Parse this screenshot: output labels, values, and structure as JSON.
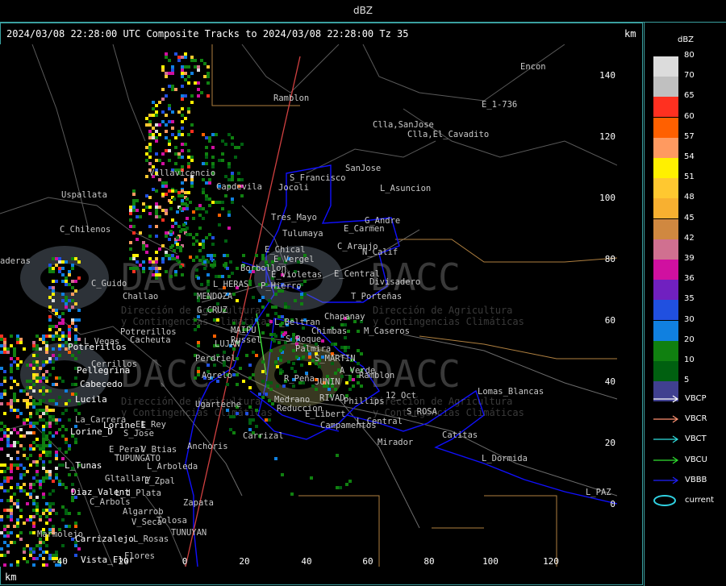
{
  "window": {
    "title": "dBZ"
  },
  "header": {
    "text": "2024/03/08 22:28:00 UTC Composite Tracks to 2024/03/08 22:28:00 Tz 35",
    "km_top": "km",
    "km_bottom": "km"
  },
  "axes": {
    "x_ticks": [
      "-40",
      "-20",
      "0",
      "20",
      "40",
      "60",
      "80",
      "100",
      "120"
    ],
    "y_ticks": [
      "140",
      "120",
      "100",
      "80",
      "60",
      "40",
      "20",
      "0"
    ]
  },
  "watermark": {
    "brand": "DACC",
    "line1": "Dirección de Agricultura",
    "line2": "y Contingencias Climáticas"
  },
  "places_white": [
    "Potrerillos",
    "Pellegrina",
    "Cabecedo",
    "Lucila",
    "Lorine_D",
    "Lorine_E",
    "L_Tunas",
    "Diaz_Valent",
    "Carrizalejo",
    "Vista_Flor"
  ],
  "places_gray": [
    "Ramblon",
    "Encon",
    "E_1-736",
    "Clla,SanJose",
    "Clla,El_Cavadito",
    "SanJose",
    "S_Francisco",
    "Jocoli",
    "L_Asuncion",
    "Villavicencio",
    "Capdevila",
    "Uspallata",
    "Tres_Mayo",
    "G_Andre",
    "Tulumaya",
    "E_Carmen",
    "C_Chilenos",
    "E_Chical",
    "E_Vergel",
    "C_Araujo",
    "N_Calif",
    "Borbollon",
    "E_Violetas",
    "E_Central",
    "Divisadero",
    "C_Guido",
    "P_Hierro",
    "L_HERAS",
    "Challao",
    "MENDOZA",
    "T_Porteñas",
    "G_CRUZ",
    "Chapanay",
    "L_Beltran",
    "Chimbas",
    "M_Caseros",
    "Potrerillos",
    "Cacheuta",
    "L_Vegas",
    "MAIPU",
    "Russel",
    "S_Roque",
    "LUJAN",
    "Palmira",
    "S_MARTIN",
    "Perdriel",
    "A_Verde",
    "Ramblon",
    "Agrelo",
    "R_Peña",
    "JUNIN",
    "RIVAD",
    "Phillips",
    "12_Oct",
    "Lomas_Blancas",
    "Medrano",
    "Reduccion",
    "E_Libert",
    "S_ROSA",
    "Ugarteche",
    "L_Central",
    "Campamentos",
    "El_Rey",
    "Carrizal",
    "S_Jose",
    "Catitas",
    "Mirador",
    "E_Peral",
    "V_Btias",
    "Anchoris",
    "TUPUNGATO",
    "L_Arboleda",
    "L_Dormida",
    "Gltallary",
    "E_Zpal",
    "L_d_Plata",
    "L_PAZ",
    "C_Arbols",
    "Zapata",
    "Algarrob",
    "V_Seca",
    "Tolosa",
    "TUNUYAN",
    "L_Rosas",
    "Flores",
    "Marmolejo",
    "La_Carrera",
    "Cerrillos",
    "aderas"
  ],
  "legend": {
    "title": "dBZ",
    "scale": [
      {
        "label": "80",
        "color": "#dcdcdc"
      },
      {
        "label": "70",
        "color": "#c0c0c0"
      },
      {
        "label": "65",
        "color": "#ff3020"
      },
      {
        "label": "60",
        "color": "#ff6000"
      },
      {
        "label": "57",
        "color": "#ff9a60"
      },
      {
        "label": "54",
        "color": "#fff000"
      },
      {
        "label": "51",
        "color": "#ffc830"
      },
      {
        "label": "48",
        "color": "#f8b030"
      },
      {
        "label": "45",
        "color": "#d08840"
      },
      {
        "label": "42",
        "color": "#d07090"
      },
      {
        "label": "39",
        "color": "#d010a0"
      },
      {
        "label": "36",
        "color": "#7020c0"
      },
      {
        "label": "35",
        "color": "#2050e0"
      },
      {
        "label": "30",
        "color": "#1080e0"
      },
      {
        "label": "20",
        "color": "#108010"
      },
      {
        "label": "10",
        "color": "#006010"
      },
      {
        "label": "5",
        "color": "#404090"
      }
    ],
    "tracks": [
      {
        "label": "VBCP",
        "color": "#ffffff"
      },
      {
        "label": "VBCR",
        "color": "#ff9070"
      },
      {
        "label": "VBCT",
        "color": "#30e0e0"
      },
      {
        "label": "VBCU",
        "color": "#30e030"
      },
      {
        "label": "VBBB",
        "color": "#2020ff"
      },
      {
        "label": "current",
        "color": "#30d0e0"
      }
    ]
  }
}
